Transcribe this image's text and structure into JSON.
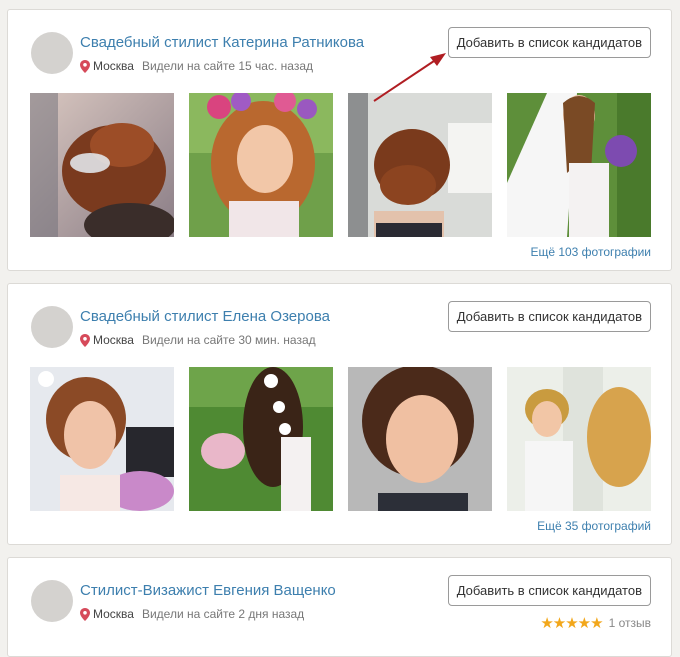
{
  "cards": [
    {
      "name": "Свадебный стилист Катерина Ратникова",
      "city": "Москва",
      "seen": "Видели на сайте 15 час. назад",
      "add_button": "Добавить в список кандидатов",
      "more_photos": "Ещё 103 фотографии"
    },
    {
      "name": "Свадебный стилист Елена Озерова",
      "city": "Москва",
      "seen": "Видели на сайте 30 мин. назад",
      "add_button": "Добавить в список кандидатов",
      "more_photos": "Ещё 35 фотографий"
    },
    {
      "name": "Стилист-Визажист Евгения Ващенко",
      "city": "Москва",
      "seen": "Видели на сайте 2 дня назад",
      "add_button": "Добавить в список кандидатов",
      "rating_stars": "★★★★★",
      "rating": 5,
      "reviews": "1 отзыв"
    }
  ],
  "colors": {
    "link": "#3d7fae",
    "pin": "#d64a5a",
    "star": "#f2a71b",
    "annotation_arrow": "#b01e23"
  }
}
